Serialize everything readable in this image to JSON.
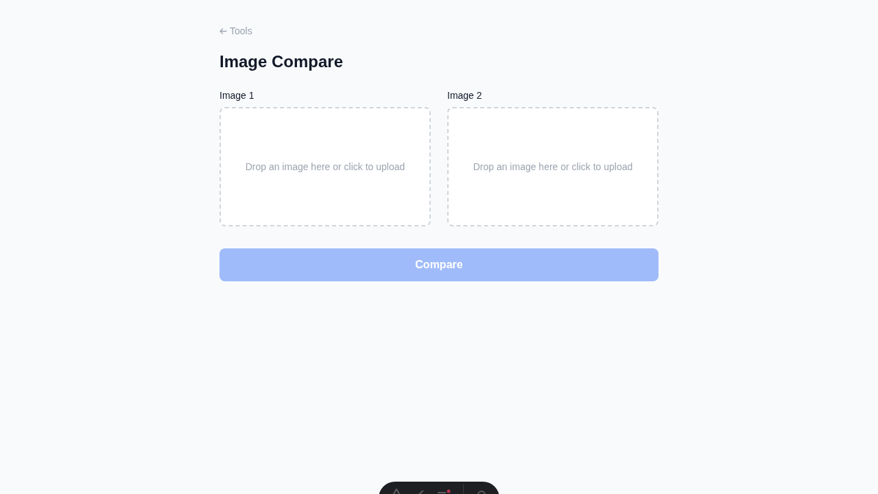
{
  "back_link": {
    "label": "Tools"
  },
  "title": "Image Compare",
  "images": [
    {
      "label": "Image 1",
      "placeholder": "Drop an image here or click to upload"
    },
    {
      "label": "Image 2",
      "placeholder": "Drop an image here or click to upload"
    }
  ],
  "compare_button": {
    "label": "Compare",
    "disabled": true
  }
}
